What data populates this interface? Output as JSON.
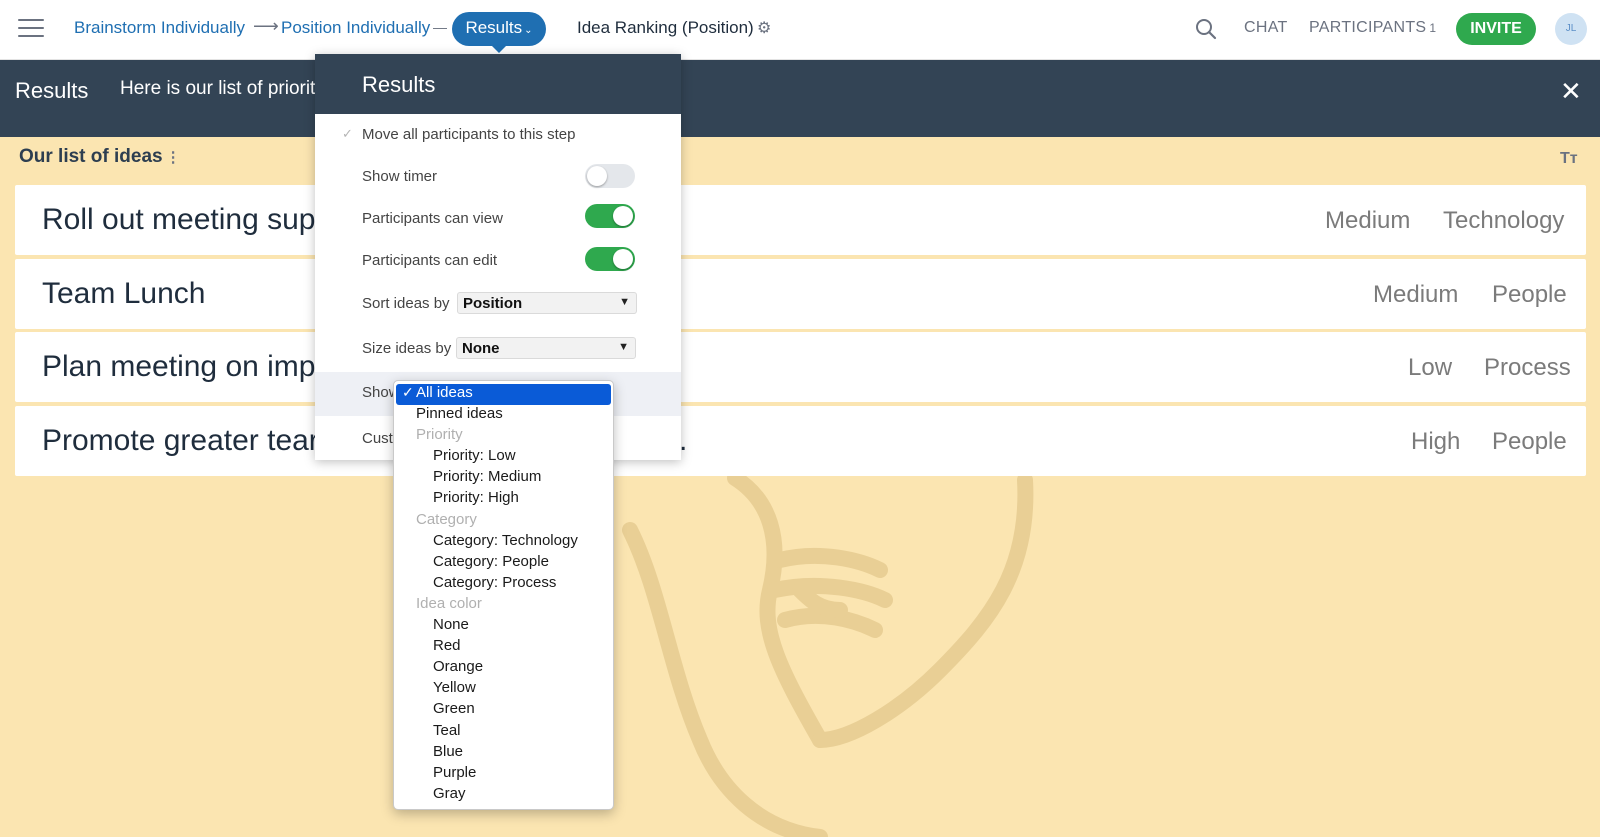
{
  "colors": {
    "brand": "#1f6fb2",
    "invite": "#2fa94e",
    "header": "#334455",
    "background": "#fbe5b1",
    "selected_option": "#0a5bd7"
  },
  "topbar": {
    "menu_icon": "hamburger-icon",
    "breadcrumb": [
      {
        "label": "Brainstorm Individually"
      },
      {
        "label": "Position Individually"
      }
    ],
    "arrow": "⟶",
    "current_step": "Results",
    "step_title": "Idea Ranking (Position)",
    "chat_label": "CHAT",
    "participants_label": "PARTICIPANTS",
    "participants_count": "1",
    "invite_label": "INVITE",
    "avatar_initials": "JL"
  },
  "header": {
    "title": "Results",
    "description": "Here is our list of priorit"
  },
  "list": {
    "title": "Our list of ideas",
    "ideas": [
      {
        "text": "Roll out meeting supp",
        "priority": "Medium",
        "category": "Technology"
      },
      {
        "text": "Team Lunch",
        "priority": "Medium",
        "category": "People"
      },
      {
        "text": "Plan meeting on impr",
        "priority": "Low",
        "category": "Process"
      },
      {
        "text": "Promote greater tear",
        "priority": "High",
        "category": "People",
        "trailing": "."
      }
    ]
  },
  "settings": {
    "title": "Results",
    "move_all": "Move all participants to this step",
    "show_timer": {
      "label": "Show timer",
      "on": false
    },
    "can_view": {
      "label": "Participants can view",
      "on": true
    },
    "can_edit": {
      "label": "Participants can edit",
      "on": true
    },
    "sort_label": "Sort ideas by",
    "sort_value": "Position",
    "size_label": "Size ideas by",
    "size_value": "None",
    "show_label": "Show",
    "custom_label": "Cust"
  },
  "show_dropdown": {
    "options": [
      {
        "label": "All ideas",
        "kind": "top",
        "selected": true
      },
      {
        "label": "Pinned ideas",
        "kind": "top"
      },
      {
        "label": "Priority",
        "kind": "group"
      },
      {
        "label": "Priority: Low",
        "kind": "sub"
      },
      {
        "label": "Priority: Medium",
        "kind": "sub"
      },
      {
        "label": "Priority: High",
        "kind": "sub"
      },
      {
        "label": "Category",
        "kind": "group"
      },
      {
        "label": "Category: Technology",
        "kind": "sub"
      },
      {
        "label": "Category: People",
        "kind": "sub"
      },
      {
        "label": "Category: Process",
        "kind": "sub"
      },
      {
        "label": "Idea color",
        "kind": "group"
      },
      {
        "label": "None",
        "kind": "sub"
      },
      {
        "label": "Red",
        "kind": "sub"
      },
      {
        "label": "Orange",
        "kind": "sub"
      },
      {
        "label": "Yellow",
        "kind": "sub"
      },
      {
        "label": "Green",
        "kind": "sub"
      },
      {
        "label": "Teal",
        "kind": "sub"
      },
      {
        "label": "Blue",
        "kind": "sub"
      },
      {
        "label": "Purple",
        "kind": "sub"
      },
      {
        "label": "Gray",
        "kind": "sub"
      }
    ]
  }
}
